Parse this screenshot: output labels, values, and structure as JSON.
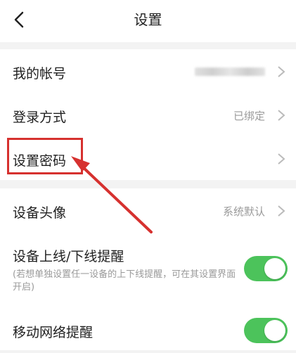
{
  "header": {
    "title": "设置",
    "back_icon": "chevron-left-icon"
  },
  "rows": [
    {
      "label": "我的帐号",
      "value": "",
      "value_obscured": true
    },
    {
      "label": "登录方式",
      "value": "已绑定"
    },
    {
      "label": "设置密码",
      "value": ""
    },
    {
      "label": "设备头像",
      "value": "系统默认"
    },
    {
      "label": "设备上线/下线提醒",
      "sub": "(若想单独设置任一设备的上下线提醒，可在其设置界面开启)",
      "toggle": true
    },
    {
      "label": "移动网络提醒",
      "toggle": true
    }
  ],
  "colors": {
    "toggle_on": "#4cc35b",
    "annotation_red": "#d6312f"
  }
}
